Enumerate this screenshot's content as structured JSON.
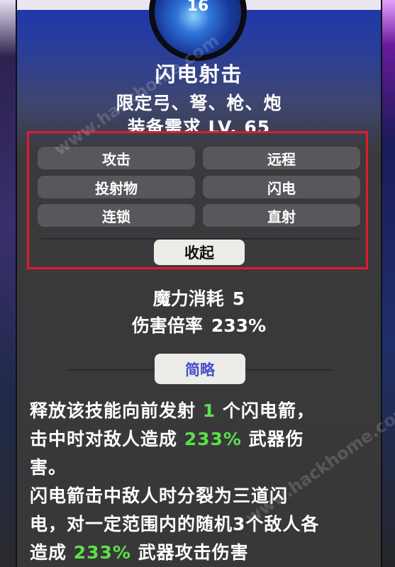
{
  "skill": {
    "level_badge": "16",
    "name": "闪电射击",
    "weapons": "限定弓、弩、枪、炮",
    "requirement": "装备需求 LV. 65"
  },
  "tags": [
    "攻击",
    "远程",
    "投射物",
    "闪电",
    "连锁",
    "直射"
  ],
  "collapse_label": "收起",
  "stats": {
    "mana_label": "魔力消耗",
    "mana_value": "5",
    "damage_label": "伤害倍率",
    "damage_value": "233%"
  },
  "summary_label": "简略",
  "description": {
    "l1a": "释放该技能向前发射 ",
    "l1b": "1",
    "l1c": " 个闪电箭，",
    "l2a": "击中时对敌人造成 ",
    "l2b": "233%",
    "l2c": " 武器伤",
    "l3": "害。",
    "l4": "闪电箭击中敌人时分裂为三道闪",
    "l5": "电，对一定范围内的随机3个敌人各",
    "l6a": "造成 ",
    "l6b": "233%",
    "l6c": " 武器攻击伤害"
  },
  "watermark": "www.hackhome.com",
  "colors": {
    "highlight": "#5be04a",
    "frame_red": "#e21b2c",
    "title_blue": "#1e37ad"
  }
}
